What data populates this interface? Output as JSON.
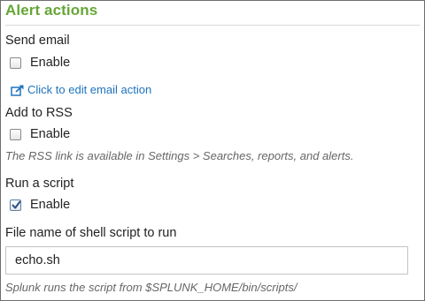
{
  "title": "Alert actions",
  "send_email": {
    "label": "Send email",
    "enable_label": "Enable",
    "enabled": false,
    "edit_link": "Click to edit email action"
  },
  "add_to_rss": {
    "label": "Add to RSS",
    "enable_label": "Enable",
    "enabled": false,
    "hint": "The RSS link is available in Settings > Searches, reports, and alerts."
  },
  "run_script": {
    "label": "Run a script",
    "enable_label": "Enable",
    "enabled": true,
    "file_label": "File name of shell script to run",
    "file_value": "echo.sh",
    "hint": "Splunk runs the script from $SPLUNK_HOME/bin/scripts/"
  },
  "colors": {
    "title": "#65a637",
    "link": "#1e73be",
    "hint": "#666666"
  },
  "icons": {
    "edit_link": "external-edit-icon",
    "checked": "checkmark-icon"
  }
}
